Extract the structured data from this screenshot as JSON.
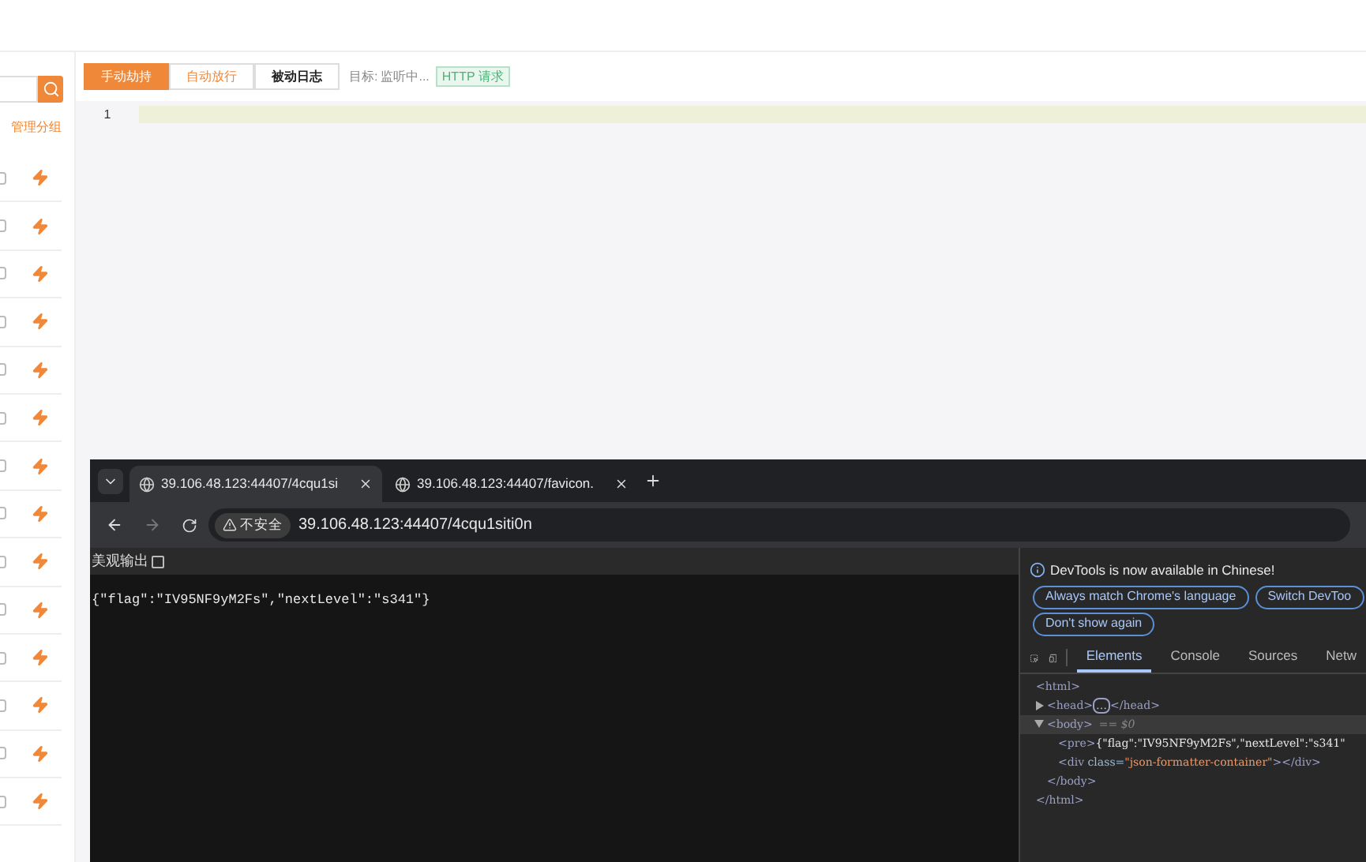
{
  "sidebar": {
    "manage_link": "管理分组",
    "rows": [
      {
        "checked": false
      },
      {
        "checked": false
      },
      {
        "checked": false
      },
      {
        "checked": false
      },
      {
        "checked": false
      },
      {
        "checked": false
      },
      {
        "checked": false
      },
      {
        "checked": false
      },
      {
        "checked": false
      },
      {
        "checked": false
      },
      {
        "checked": false
      },
      {
        "checked": false
      },
      {
        "checked": false
      },
      {
        "checked": false
      }
    ]
  },
  "tabs": [
    {
      "label": "手动劫持",
      "selected": true,
      "hovered": false
    },
    {
      "label": "自动放行",
      "selected": false,
      "hovered": false
    },
    {
      "label": "被动日志",
      "selected": false,
      "hovered": true
    }
  ],
  "target": {
    "label": "目标:",
    "value": "监听中...",
    "badge": "HTTP 请求"
  },
  "editor": {
    "line_numbers": [
      "1"
    ]
  },
  "browser": {
    "tabs": [
      {
        "title": "39.106.48.123:44407/4cqu1si",
        "selected": true
      },
      {
        "title": "39.106.48.123:44407/favicon.",
        "selected": false
      }
    ],
    "security": "不安全",
    "url": "39.106.48.123:44407/4cqu1siti0n",
    "page": {
      "pretty_print": {
        "label": "美观输出",
        "checked": false
      },
      "body": "{\"flag\":\"IV95NF9yM2Fs\",\"nextLevel\":\"s341\"}"
    },
    "devtools": {
      "notice": "DevTools is now available in Chinese!",
      "buttons": [
        "Always match Chrome's language",
        "Switch DevToo",
        "Don't show again"
      ],
      "tabs": [
        {
          "label": "Elements",
          "selected": true
        },
        {
          "label": "Console",
          "selected": false
        },
        {
          "label": "Sources",
          "selected": false
        },
        {
          "label": "Netw",
          "selected": false
        }
      ],
      "tree": [
        {
          "kind": "line",
          "parts": [
            {
              "kind": "tag",
              "text": "<html>"
            }
          ],
          "children": [
            {
              "kind": "collapsed",
              "parts": [
                {
                  "kind": "tag",
                  "text": "<head>"
                },
                {
                  "kind": "ellipsis",
                  "text": "…"
                },
                {
                  "kind": "tag",
                  "text": "</head>"
                }
              ]
            },
            {
              "kind": "expanded",
              "selected": true,
              "parts": [
                {
                  "kind": "tag",
                  "text": "<body>"
                },
                {
                  "kind": "note",
                  "text": "== $0"
                }
              ],
              "children": [
                {
                  "kind": "line",
                  "parts": [
                    {
                      "kind": "tag",
                      "text": "<pre>"
                    },
                    {
                      "kind": "text",
                      "text": "{\"flag\":\"IV95NF9yM2Fs\",\"nextLevel\":\"s341\""
                    }
                  ]
                },
                {
                  "kind": "line",
                  "parts": [
                    {
                      "kind": "tag",
                      "text": "<div "
                    },
                    {
                      "kind": "attr",
                      "text": "class="
                    },
                    {
                      "kind": "value",
                      "text": "\"json-formatter-container\""
                    },
                    {
                      "kind": "tag",
                      "text": "></div>"
                    }
                  ]
                }
              ]
            },
            {
              "kind": "line",
              "parts": [
                {
                  "kind": "tag",
                  "text": "</body>"
                }
              ]
            }
          ]
        },
        {
          "kind": "line",
          "parts": [
            {
              "kind": "tag",
              "text": "</html>"
            }
          ]
        }
      ]
    }
  }
}
